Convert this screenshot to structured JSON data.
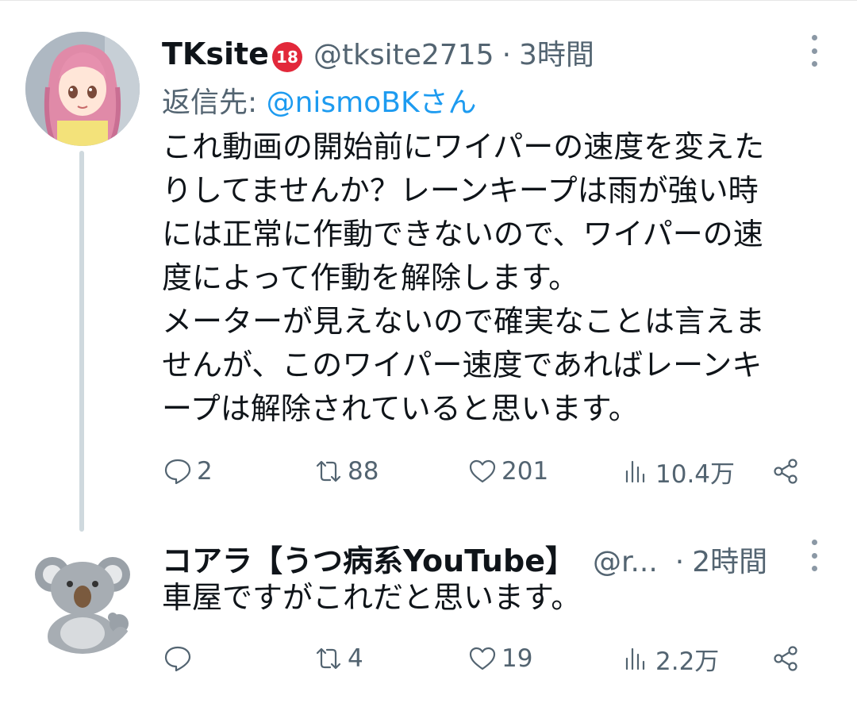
{
  "tweets": [
    {
      "author": {
        "name": "TKsite",
        "badge": "18",
        "handle": "@tksite2715"
      },
      "separator": "·",
      "time": "3時間",
      "reply_to": {
        "label": "返信先: ",
        "mention": "@nismoBKさん"
      },
      "body_lines": [
        "これ動画の開始前にワイパーの速度を変えた",
        "りしてませんか？レーンキープは雨が強い時",
        "には正常に作動できないので、ワイパーの速",
        "度によって作動を解除します。",
        "メーターが見えないので確実なことは言えま",
        "せんが、このワイパー速度であればレーンキ",
        "ープは解除されていると思います。"
      ],
      "stats": {
        "replies": "2",
        "retweets": "88",
        "likes": "201",
        "views": "10.4万"
      }
    },
    {
      "author": {
        "name": "コアラ【うつ病系YouTube】",
        "handle": "@r..."
      },
      "separator": "·",
      "time": "2時間",
      "body": "車屋ですがこれだと思います。",
      "stats": {
        "replies": "",
        "retweets": "4",
        "likes": "19",
        "views": "2.2万"
      }
    }
  ],
  "icons": {
    "reply": "reply-icon",
    "retweet": "retweet-icon",
    "like": "heart-icon",
    "views": "views-icon",
    "share": "share-icon",
    "more": "more-vertical-icon"
  },
  "colors": {
    "text": "#0f1419",
    "secondary": "#536471",
    "link": "#1d9bf0",
    "badge": "#e2283a",
    "thread_line": "#cfd9de"
  }
}
